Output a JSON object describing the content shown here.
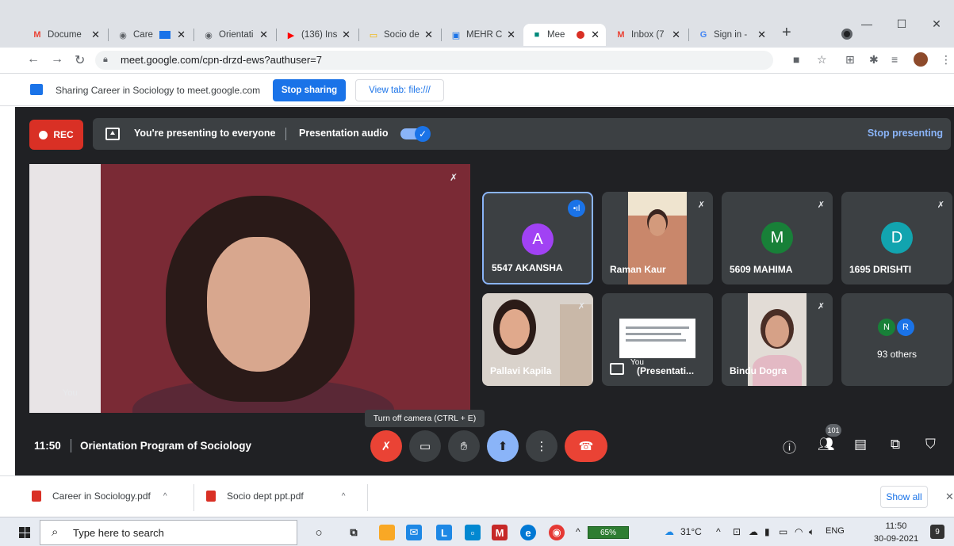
{
  "tabs": [
    {
      "label": "Docume",
      "icon": "gmail-icon",
      "color": "#ea4335",
      "fav": "M"
    },
    {
      "label": "Care",
      "icon": "chrome-icon",
      "color": "#5f6368",
      "fav": "◉"
    },
    {
      "label": "Orientati",
      "icon": "chrome-icon",
      "color": "#5f6368",
      "fav": "◉"
    },
    {
      "label": "(136) Ins",
      "icon": "youtube-icon",
      "color": "#ff0000",
      "fav": "▶"
    },
    {
      "label": "Socio de",
      "icon": "slides-icon",
      "color": "#f4b400",
      "fav": "▭"
    },
    {
      "label": "MEHR C",
      "icon": "classroom-icon",
      "color": "#1a73e8",
      "fav": "▣"
    },
    {
      "label": "Mee",
      "icon": "meet-icon",
      "color": "#00897b",
      "fav": "■"
    },
    {
      "label": "Inbox (7",
      "icon": "gmail-icon",
      "color": "#ea4335",
      "fav": "M"
    },
    {
      "label": "Sign in -",
      "icon": "google-icon",
      "color": "#4285f4",
      "fav": "G"
    }
  ],
  "address_bar": {
    "url": "meet.google.com/cpn-drzd-ews?authuser=7"
  },
  "share_bar": {
    "text": "Sharing Career in Sociology to meet.google.com",
    "stop_sharing": "Stop sharing",
    "view_tab": "View tab: file:///"
  },
  "meet": {
    "rec": "REC",
    "presenting_text": "You're presenting to everyone",
    "presentation_audio": "Presentation audio",
    "presentation_audio_on": true,
    "stop_presenting": "Stop presenting",
    "main_label": "You",
    "tooltip": "Turn off camera (CTRL + E)",
    "time": "11:50",
    "meeting_title": "Orientation Program of Sociology",
    "participant_count": "101",
    "accent": "#8ab4f8",
    "danger": "#ea4335"
  },
  "tiles": [
    {
      "name": "5547 AKANSHA",
      "initial": "A",
      "color": "#a142f4"
    },
    {
      "name": "Raman Kaur"
    },
    {
      "name": "5609 MAHIMA",
      "initial": "M",
      "color": "#188038"
    },
    {
      "name": "1695 DRISHTI",
      "initial": "D",
      "color": "#12a4af"
    },
    {
      "name": "Pallavi Kapila"
    },
    {
      "name": "(Presentati...",
      "owner": "You"
    },
    {
      "name": "Bindu Dogra"
    },
    {
      "name": "93 others",
      "avatars": [
        {
          "initial": "N",
          "color": "#188038"
        },
        {
          "initial": "R",
          "color": "#1a73e8"
        }
      ]
    }
  ],
  "downloads": [
    {
      "name": "Career in Sociology.pdf"
    },
    {
      "name": "Socio dept ppt.pdf"
    }
  ],
  "show_all": "Show all",
  "taskbar": {
    "search_placeholder": "Type here to search",
    "battery": "65%",
    "temperature": "31°C",
    "language": "ENG",
    "time": "11:50",
    "date": "30-09-2021",
    "notifications": "9"
  }
}
